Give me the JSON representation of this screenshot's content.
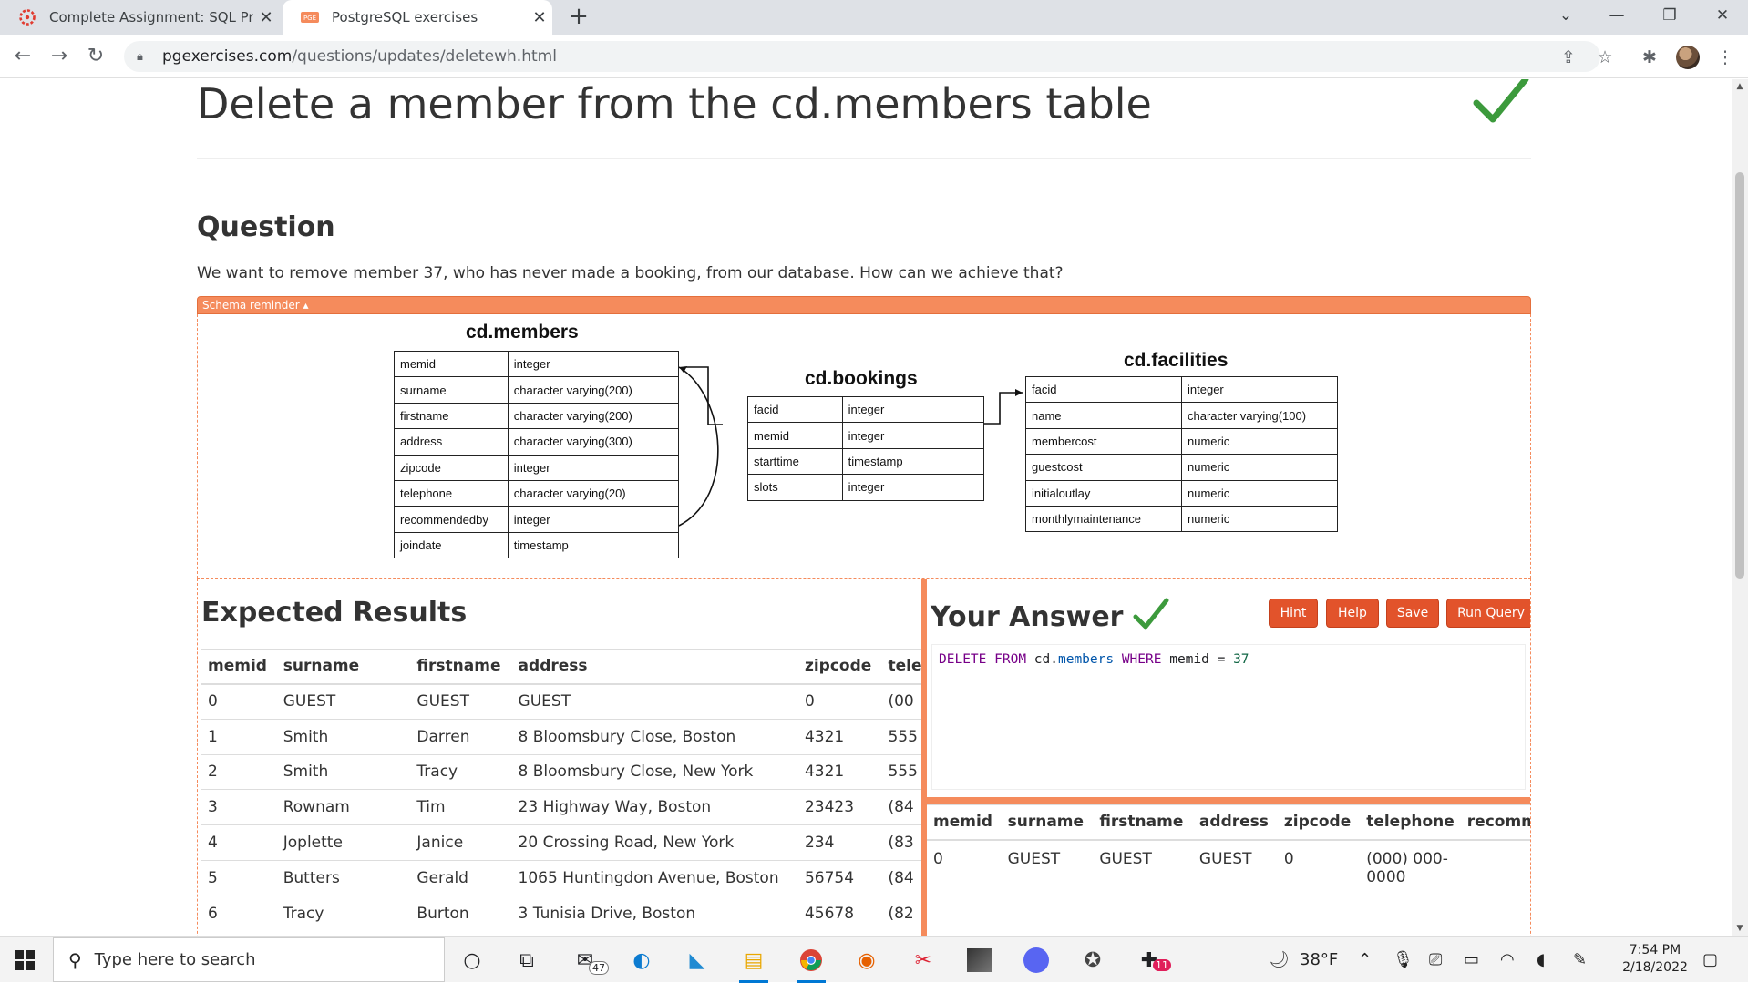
{
  "browser": {
    "tabs": [
      {
        "title": "Complete Assignment: SQL Practi",
        "active": false,
        "icon": "canvas-icon"
      },
      {
        "title": "PostgreSQL exercises",
        "active": true,
        "icon": "pge-icon"
      }
    ],
    "url_host": "pgexercises.com",
    "url_path": "/questions/updates/deletewh.html"
  },
  "page": {
    "title": "Delete a member from the cd.members table",
    "question_heading": "Question",
    "question_text": "We want to remove member 37, who has never made a booking, from our database. How can we achieve that?",
    "schema_toggle": "Schema reminder ▴",
    "accent_color": "#f58b5c",
    "button_color": "#e2532b"
  },
  "schema": {
    "members": {
      "title": "cd.members",
      "rows": [
        [
          "memid",
          "integer"
        ],
        [
          "surname",
          "character varying(200)"
        ],
        [
          "firstname",
          "character varying(200)"
        ],
        [
          "address",
          "character varying(300)"
        ],
        [
          "zipcode",
          "integer"
        ],
        [
          "telephone",
          "character varying(20)"
        ],
        [
          "recommendedby",
          "integer"
        ],
        [
          "joindate",
          "timestamp"
        ]
      ]
    },
    "bookings": {
      "title": "cd.bookings",
      "rows": [
        [
          "facid",
          "integer"
        ],
        [
          "memid",
          "integer"
        ],
        [
          "starttime",
          "timestamp"
        ],
        [
          "slots",
          "integer"
        ]
      ]
    },
    "facilities": {
      "title": "cd.facilities",
      "rows": [
        [
          "facid",
          "integer"
        ],
        [
          "name",
          "character varying(100)"
        ],
        [
          "membercost",
          "numeric"
        ],
        [
          "guestcost",
          "numeric"
        ],
        [
          "initialoutlay",
          "numeric"
        ],
        [
          "monthlymaintenance",
          "numeric"
        ]
      ]
    }
  },
  "expected": {
    "heading": "Expected Results",
    "columns": [
      "memid",
      "surname",
      "firstname",
      "address",
      "zipcode",
      "tele"
    ],
    "rows": [
      [
        "0",
        "GUEST",
        "GUEST",
        "GUEST",
        "0",
        "(00"
      ],
      [
        "1",
        "Smith",
        "Darren",
        "8 Bloomsbury Close, Boston",
        "4321",
        "555"
      ],
      [
        "2",
        "Smith",
        "Tracy",
        "8 Bloomsbury Close, New York",
        "4321",
        "555"
      ],
      [
        "3",
        "Rownam",
        "Tim",
        "23 Highway Way, Boston",
        "23423",
        "(84"
      ],
      [
        "4",
        "Joplette",
        "Janice",
        "20 Crossing Road, New York",
        "234",
        "(83"
      ],
      [
        "5",
        "Butters",
        "Gerald",
        "1065 Huntingdon Avenue, Boston",
        "56754",
        "(84"
      ],
      [
        "6",
        "Tracy",
        "Burton",
        "3 Tunisia Drive, Boston",
        "45678",
        "(82"
      ]
    ]
  },
  "answer": {
    "heading": "Your Answer",
    "buttons": {
      "hint": "Hint",
      "help": "Help",
      "save": "Save",
      "run": "Run Query"
    },
    "query": {
      "kw1": "DELETE",
      "kw2": "FROM",
      "schema": "cd.",
      "table": "members",
      "kw3": "WHERE",
      "col": "memid",
      "op": "=",
      "value": "37"
    },
    "result_columns": [
      "memid",
      "surname",
      "firstname",
      "address",
      "zipcode",
      "telephone",
      "recomm"
    ],
    "result_rows": [
      [
        "0",
        "GUEST",
        "GUEST",
        "GUEST",
        "0",
        "(000) 000-0000",
        ""
      ]
    ]
  },
  "taskbar": {
    "search_placeholder": "Type here to search",
    "mail_badge": "47",
    "slack_badge": "11",
    "weather": "38°F",
    "time": "7:54 PM",
    "date": "2/18/2022"
  }
}
